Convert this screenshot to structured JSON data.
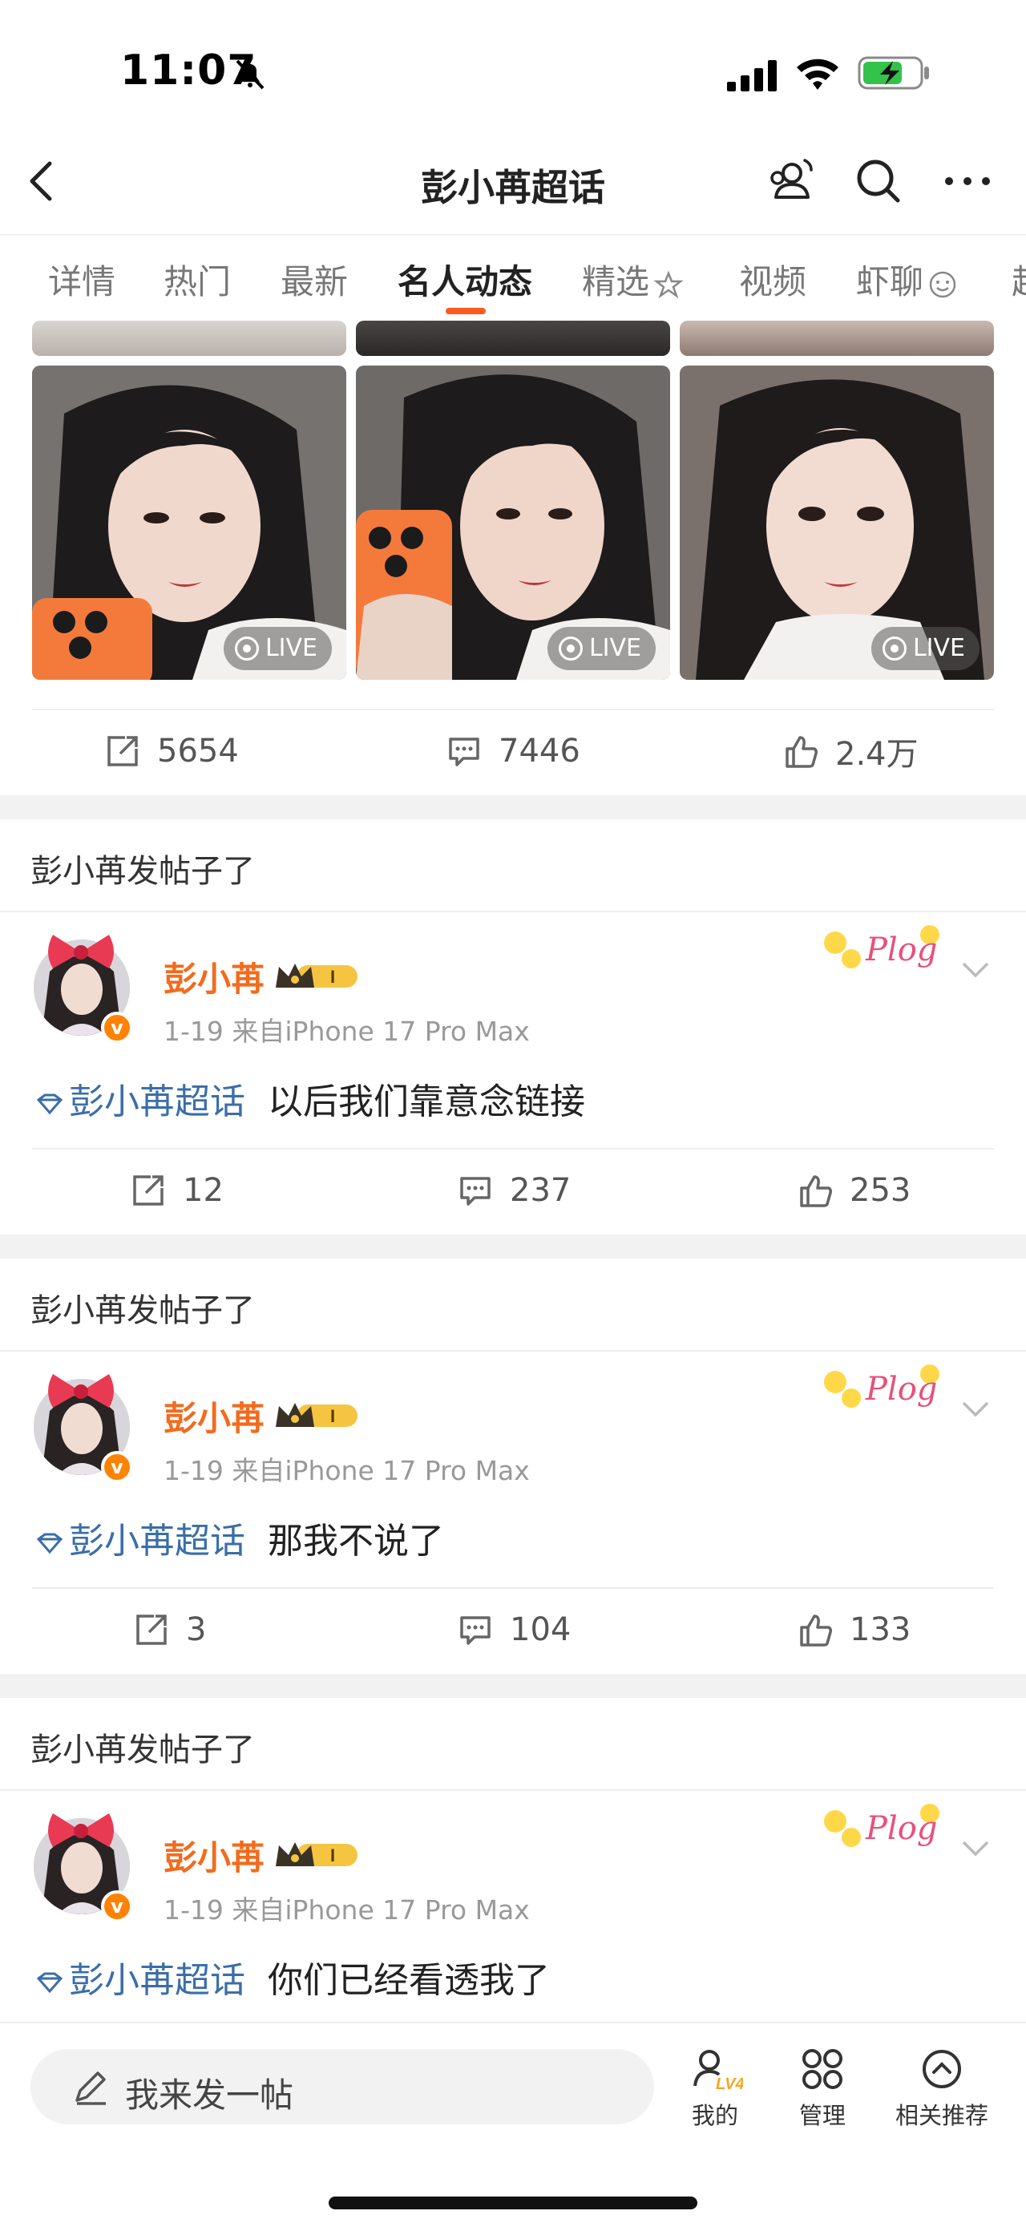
{
  "status": {
    "time": "11:07"
  },
  "header": {
    "title": "彭小苒超话"
  },
  "tabs": [
    "详情",
    "热门",
    "最新",
    "名人动态",
    "精选",
    "视频",
    "虾聊"
  ],
  "gallery": {
    "live_label": "LIVE"
  },
  "first_post_actions": {
    "repost": "5654",
    "comment": "7446",
    "like": "2.4万"
  },
  "posts": [
    {
      "section": "彭小苒发帖子了",
      "author": "彭小苒",
      "meta": "1-19  来自iPhone 17 Pro Max",
      "topic": "彭小苒超话",
      "text": "以后我们靠意念链接",
      "repost": "12",
      "comment": "237",
      "like": "253"
    },
    {
      "section": "彭小苒发帖子了",
      "author": "彭小苒",
      "meta": "1-19  来自iPhone 17 Pro Max",
      "topic": "彭小苒超话",
      "text": "那我不说了",
      "repost": "3",
      "comment": "104",
      "like": "133"
    },
    {
      "section": "彭小苒发帖子了",
      "author": "彭小苒",
      "meta": "1-19  来自iPhone 17 Pro Max",
      "topic": "彭小苒超话",
      "text": "你们已经看透我了"
    }
  ],
  "badges": {
    "level": "I",
    "verified": "v",
    "plog": "Plog",
    "lv": "LV4"
  },
  "bottom": {
    "compose_placeholder": "我来发一帖",
    "nav": [
      "我的",
      "管理",
      "相关推荐"
    ]
  },
  "colors": {
    "accent": "#ff5a1f",
    "username": "#f26b1d",
    "topic": "#3a6ea8",
    "verified": "#ff8200"
  }
}
